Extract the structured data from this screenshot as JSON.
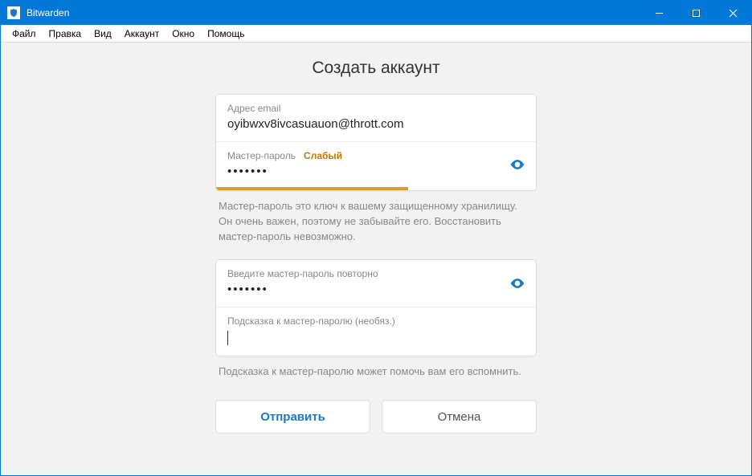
{
  "window": {
    "title": "Bitwarden"
  },
  "menu": {
    "items": [
      "Файл",
      "Правка",
      "Вид",
      "Аккаунт",
      "Окно",
      "Помощь"
    ]
  },
  "page": {
    "title": "Создать аккаунт"
  },
  "form": {
    "email": {
      "label": "Адрес email",
      "value": "oyibwxv8ivcasuauon@thrott.com"
    },
    "password": {
      "label": "Мастер-пароль",
      "strength": "Слабый",
      "value": "•••••••"
    },
    "password_hint_text": "Мастер-пароль это ключ к вашему защищенному хранилищу. Он очень важен, поэтому не забывайте его. Восстановить мастер-пароль невозможно.",
    "confirm": {
      "label": "Введите мастер-пароль повторно",
      "value": "•••••••"
    },
    "hint": {
      "label": "Подсказка к мастер-паролю (необяз.)",
      "value": ""
    },
    "hint_help": "Подсказка к мастер-паролю может помочь вам его вспомнить."
  },
  "buttons": {
    "submit": "Отправить",
    "cancel": "Отмена"
  }
}
